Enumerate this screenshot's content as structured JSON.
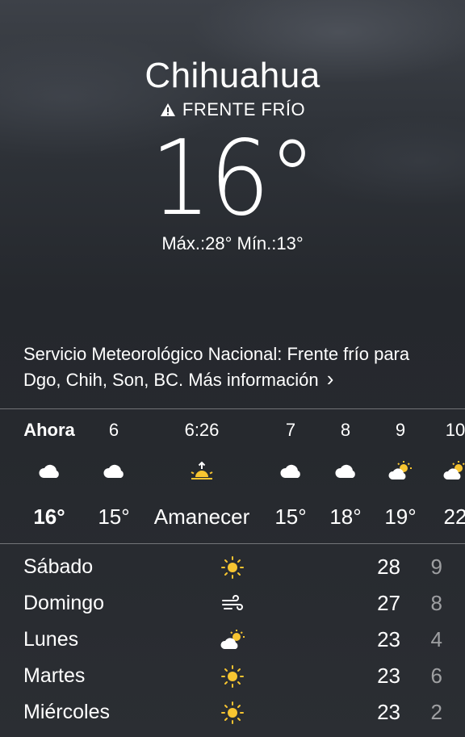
{
  "location": {
    "city": "Chihuahua",
    "alert": "FRENTE FRÍO",
    "current_temp": "16°",
    "high_low": "Máx.:28° Mín.:13°"
  },
  "notice": {
    "text": "Servicio Meteorológico Nacional: Frente frío para Dgo, Chih, Son, BC. Más información",
    "chevron": "›"
  },
  "hourly": [
    {
      "time": "Ahora",
      "icon": "cloud-icon",
      "value": "16°"
    },
    {
      "time": "6",
      "icon": "cloud-icon",
      "value": "15°"
    },
    {
      "time": "6:26",
      "icon": "sunrise-icon",
      "value": "Amanecer"
    },
    {
      "time": "7",
      "icon": "cloud-icon",
      "value": "15°"
    },
    {
      "time": "8",
      "icon": "cloud-icon",
      "value": "18°"
    },
    {
      "time": "9",
      "icon": "partly-sunny-icon",
      "value": "19°"
    },
    {
      "time": "10",
      "icon": "partly-sunny-icon",
      "value": "22"
    }
  ],
  "daily": [
    {
      "day": "Sábado",
      "icon": "sun-icon",
      "high": "28",
      "low": "9"
    },
    {
      "day": "Domingo",
      "icon": "wind-icon",
      "high": "27",
      "low": "8"
    },
    {
      "day": "Lunes",
      "icon": "partly-sunny-icon",
      "high": "23",
      "low": "4"
    },
    {
      "day": "Martes",
      "icon": "sun-icon",
      "high": "23",
      "low": "6"
    },
    {
      "day": "Miércoles",
      "icon": "sun-icon",
      "high": "23",
      "low": "2"
    }
  ],
  "colors": {
    "sun": "#f7c531",
    "text": "#ffffff",
    "low_temp": "#8c8e92"
  }
}
